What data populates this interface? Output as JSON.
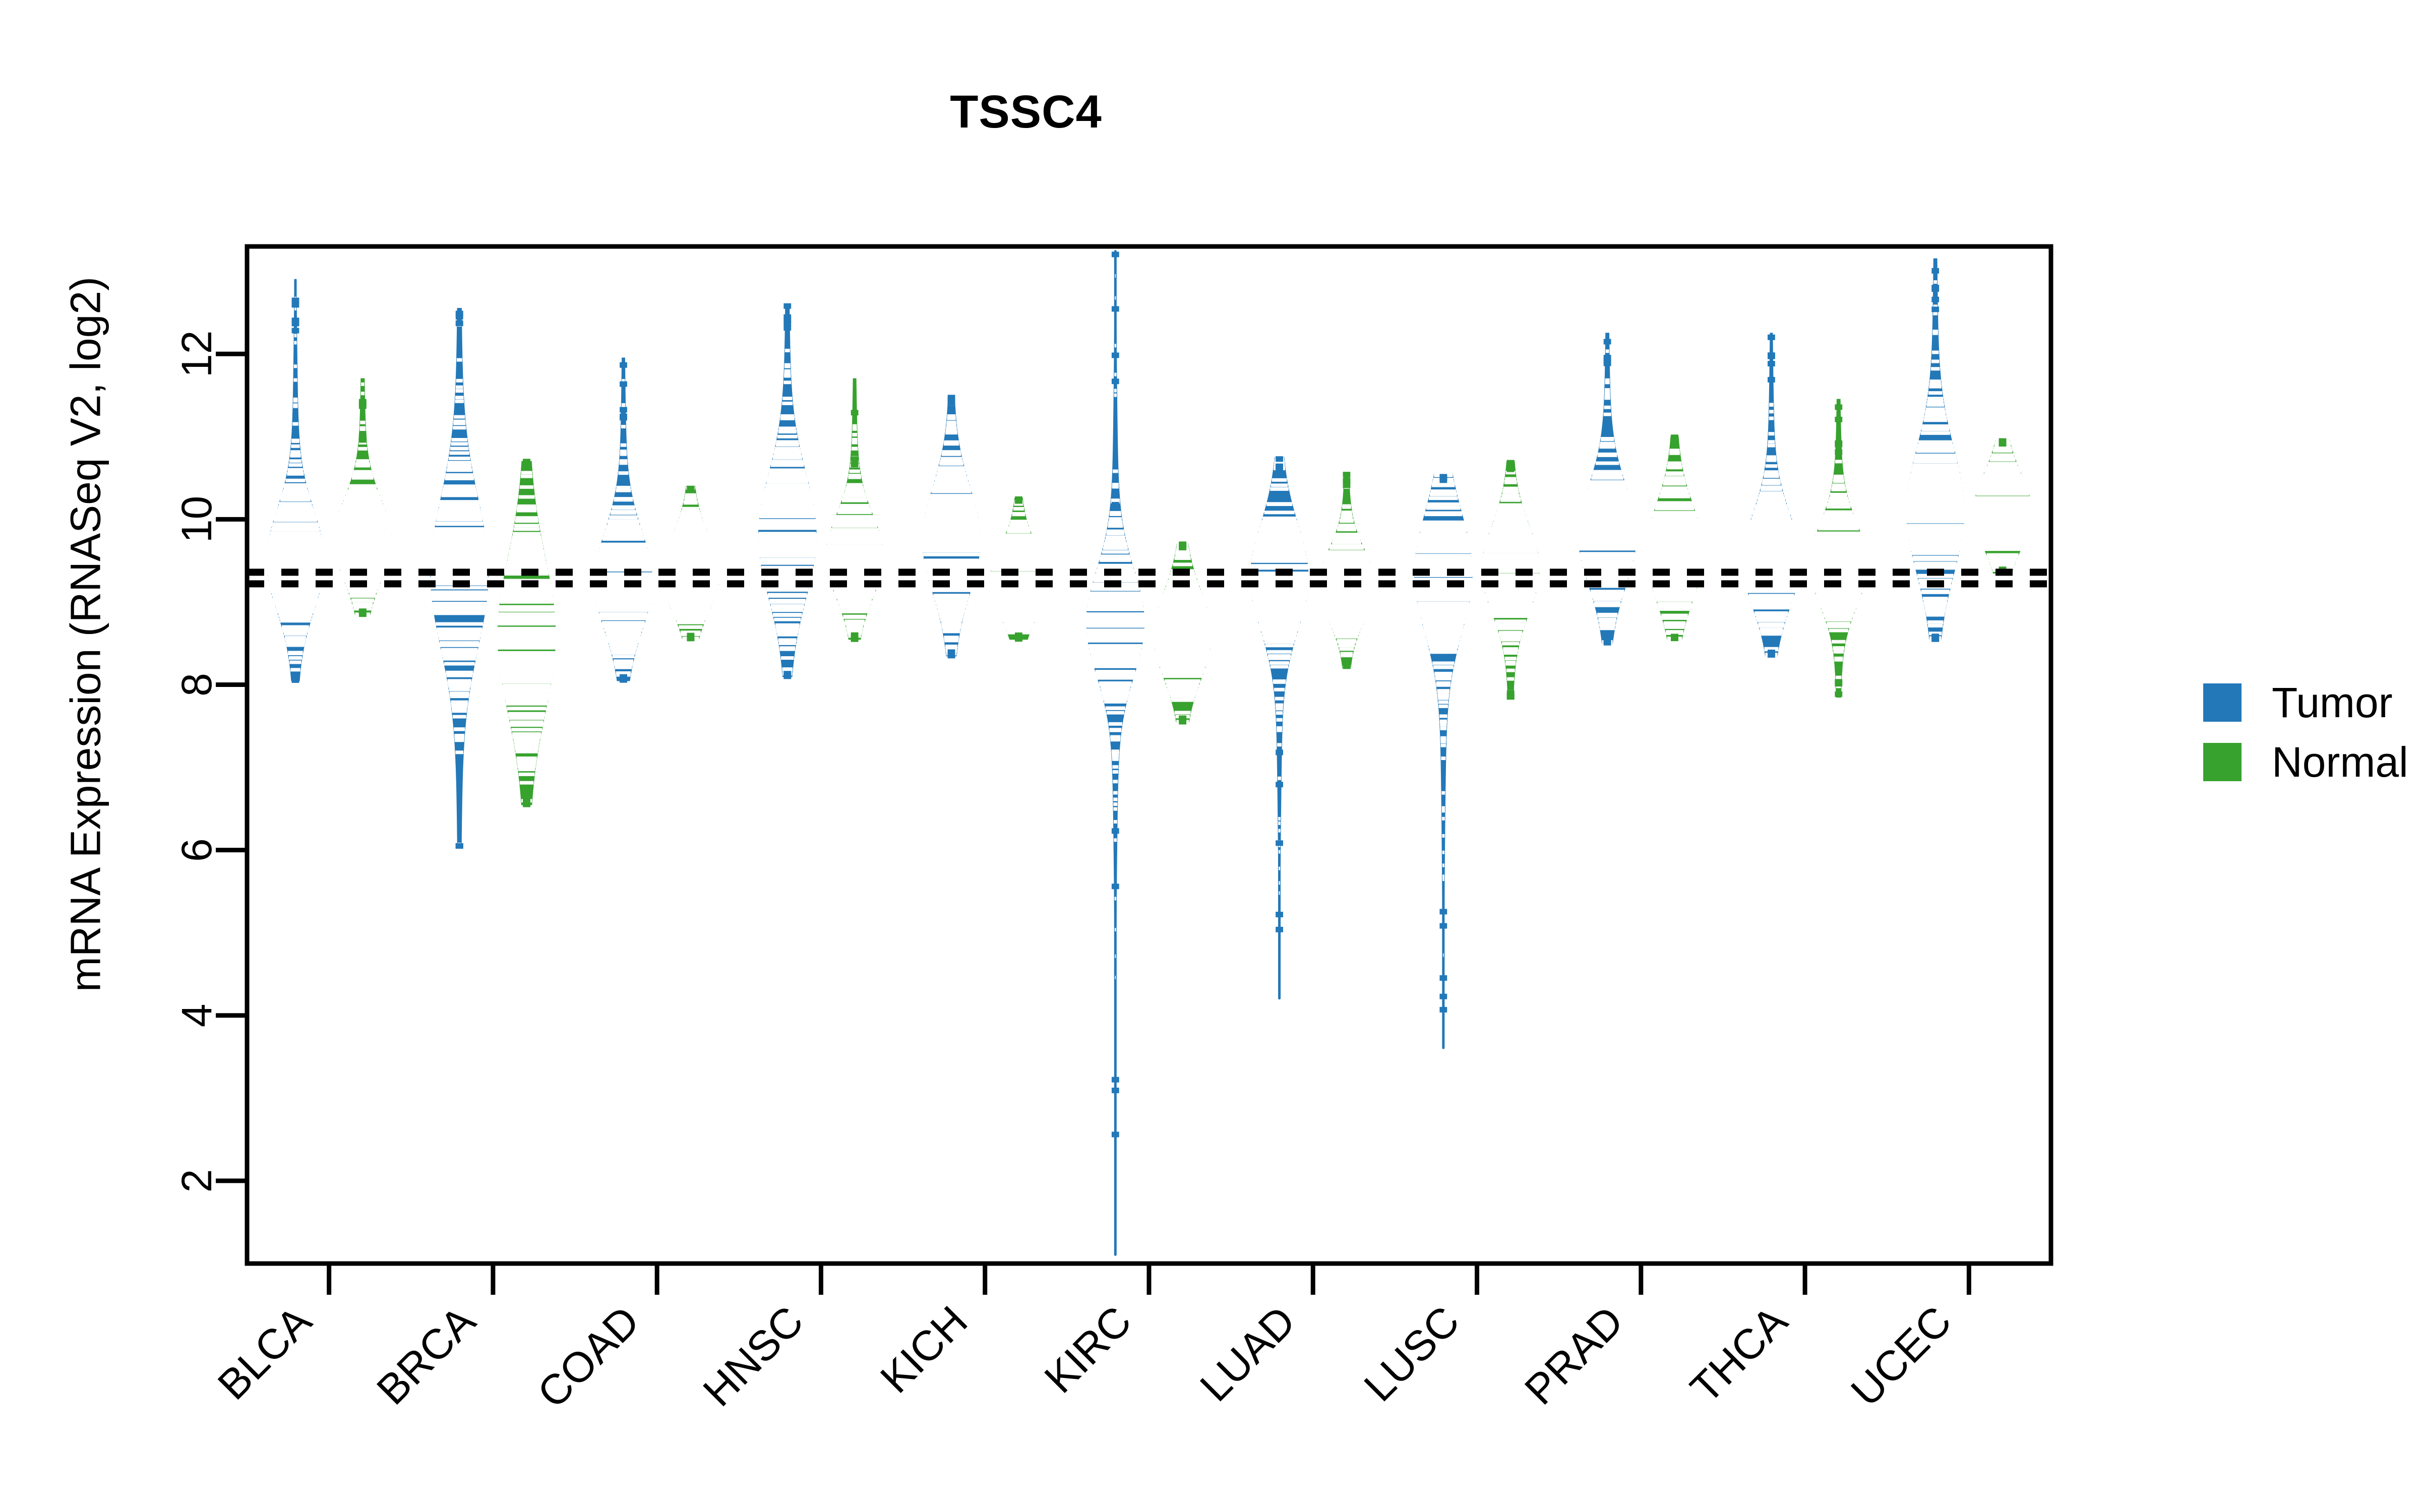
{
  "chart_data": {
    "type": "violin",
    "title": "TSSC4",
    "xlabel": "",
    "ylabel": "mRNA Expression (RNASeq V2, log2)",
    "ylim": [
      1.0,
      13.3
    ],
    "yticks": [
      2,
      4,
      6,
      8,
      10,
      12
    ],
    "ytick_labels": [
      "2",
      "4",
      "6",
      "8",
      "10",
      "12"
    ],
    "grid": false,
    "legend_position": "right",
    "categories": [
      "BLCA",
      "BRCA",
      "COAD",
      "HNSC",
      "KICH",
      "KIRC",
      "LUAD",
      "LUSC",
      "PRAD",
      "THCA",
      "UCEC"
    ],
    "reference_lines": [
      9.36,
      9.22
    ],
    "reference_line_style": "dotted",
    "reference_line_color": "#000000",
    "series": [
      {
        "name": "Tumor",
        "color": "#2378B8",
        "stats": [
          {
            "category": "BLCA",
            "median": 9.5,
            "q1": 9.15,
            "q3": 9.95,
            "min": 8.05,
            "max": 12.9,
            "whisker_low": 8.1,
            "whisker_high": 11.95
          },
          {
            "category": "BRCA",
            "median": 9.35,
            "q1": 8.7,
            "q3": 9.9,
            "min": 6.05,
            "max": 12.55,
            "whisker_low": 6.05,
            "whisker_high": 12.35
          },
          {
            "category": "COAD",
            "median": 9.25,
            "q1": 8.95,
            "q3": 9.75,
            "min": 8.05,
            "max": 11.95,
            "whisker_low": 8.1,
            "whisker_high": 11.2
          },
          {
            "category": "HNSC",
            "median": 9.8,
            "q1": 9.3,
            "q3": 10.3,
            "min": 8.1,
            "max": 12.6,
            "whisker_low": 8.15,
            "whisker_high": 12.25
          },
          {
            "category": "KICH",
            "median": 9.75,
            "q1": 9.3,
            "q3": 10.15,
            "min": 8.35,
            "max": 11.5,
            "whisker_low": 8.4,
            "whisker_high": 11.4
          },
          {
            "category": "KIRC",
            "median": 8.75,
            "q1": 8.35,
            "q3": 9.2,
            "min": 1.1,
            "max": 13.25,
            "whisker_low": 7.05,
            "whisker_high": 10.15
          },
          {
            "category": "LUAD",
            "median": 9.3,
            "q1": 8.9,
            "q3": 9.75,
            "min": 4.2,
            "max": 10.75,
            "whisker_low": 7.55,
            "whisker_high": 10.6
          },
          {
            "category": "LUSC",
            "median": 9.35,
            "q1": 8.9,
            "q3": 9.85,
            "min": 3.6,
            "max": 10.55,
            "whisker_low": 6.85,
            "whisker_high": 10.45
          },
          {
            "category": "PRAD",
            "median": 9.8,
            "q1": 9.45,
            "q3": 10.25,
            "min": 8.5,
            "max": 12.25,
            "whisker_low": 8.55,
            "whisker_high": 11.85
          },
          {
            "category": "THCA",
            "median": 9.5,
            "q1": 9.15,
            "q3": 9.9,
            "min": 8.35,
            "max": 12.25,
            "whisker_low": 8.4,
            "whisker_high": 11.6
          },
          {
            "category": "UCEC",
            "median": 10.1,
            "q1": 9.55,
            "q3": 10.55,
            "min": 8.55,
            "max": 13.15,
            "whisker_low": 8.6,
            "whisker_high": 12.45
          }
        ]
      },
      {
        "name": "Normal",
        "color": "#37A22E",
        "stats": [
          {
            "category": "BLCA",
            "median": 9.75,
            "q1": 9.45,
            "q3": 10.1,
            "min": 8.85,
            "max": 11.7,
            "whisker_low": 8.9,
            "whisker_high": 10.75
          },
          {
            "category": "BRCA",
            "median": 8.6,
            "q1": 8.1,
            "q3": 9.35,
            "min": 6.55,
            "max": 10.7,
            "whisker_low": 6.6,
            "whisker_high": 10.6
          },
          {
            "category": "COAD",
            "median": 9.35,
            "q1": 9.05,
            "q3": 9.65,
            "min": 8.55,
            "max": 10.4,
            "whisker_low": 8.6,
            "whisker_high": 10.35
          },
          {
            "category": "HNSC",
            "median": 9.55,
            "q1": 9.25,
            "q3": 9.9,
            "min": 8.55,
            "max": 11.7,
            "whisker_low": 8.6,
            "whisker_high": 10.55
          },
          {
            "category": "KICH",
            "median": 9.25,
            "q1": 9.0,
            "q3": 9.55,
            "min": 8.55,
            "max": 10.25,
            "whisker_low": 8.6,
            "whisker_high": 10.2
          },
          {
            "category": "KIRC",
            "median": 8.6,
            "q1": 8.3,
            "q3": 9.0,
            "min": 7.55,
            "max": 9.7,
            "whisker_low": 7.6,
            "whisker_high": 9.65
          },
          {
            "category": "LUAD",
            "median": 9.2,
            "q1": 8.95,
            "q3": 9.5,
            "min": 8.2,
            "max": 10.55,
            "whisker_low": 8.25,
            "whisker_high": 10.4
          },
          {
            "category": "LUSC",
            "median": 9.4,
            "q1": 9.1,
            "q3": 9.8,
            "min": 7.85,
            "max": 10.7,
            "whisker_low": 7.9,
            "whisker_high": 10.6
          },
          {
            "category": "PRAD",
            "median": 9.6,
            "q1": 9.25,
            "q3": 10.0,
            "min": 8.55,
            "max": 11.0,
            "whisker_low": 8.6,
            "whisker_high": 10.95
          },
          {
            "category": "THCA",
            "median": 9.45,
            "q1": 9.15,
            "q3": 9.8,
            "min": 7.85,
            "max": 11.45,
            "whisker_low": 8.55,
            "whisker_high": 10.6
          },
          {
            "category": "UCEC",
            "median": 10.1,
            "q1": 9.8,
            "q3": 10.4,
            "min": 9.35,
            "max": 10.95,
            "whisker_low": 9.4,
            "whisker_high": 10.9
          }
        ]
      }
    ]
  },
  "legend": {
    "items": [
      {
        "label": "Tumor",
        "color": "#2378B8"
      },
      {
        "label": "Normal",
        "color": "#37A22E"
      }
    ]
  },
  "axes": {
    "y_title": "mRNA Expression (RNASeq V2, log2)",
    "y_tick_labels": [
      "2",
      "4",
      "6",
      "8",
      "10",
      "12"
    ],
    "x_tick_labels": [
      "BLCA",
      "BRCA",
      "COAD",
      "HNSC",
      "KICH",
      "KIRC",
      "LUAD",
      "LUSC",
      "PRAD",
      "THCA",
      "UCEC"
    ]
  }
}
